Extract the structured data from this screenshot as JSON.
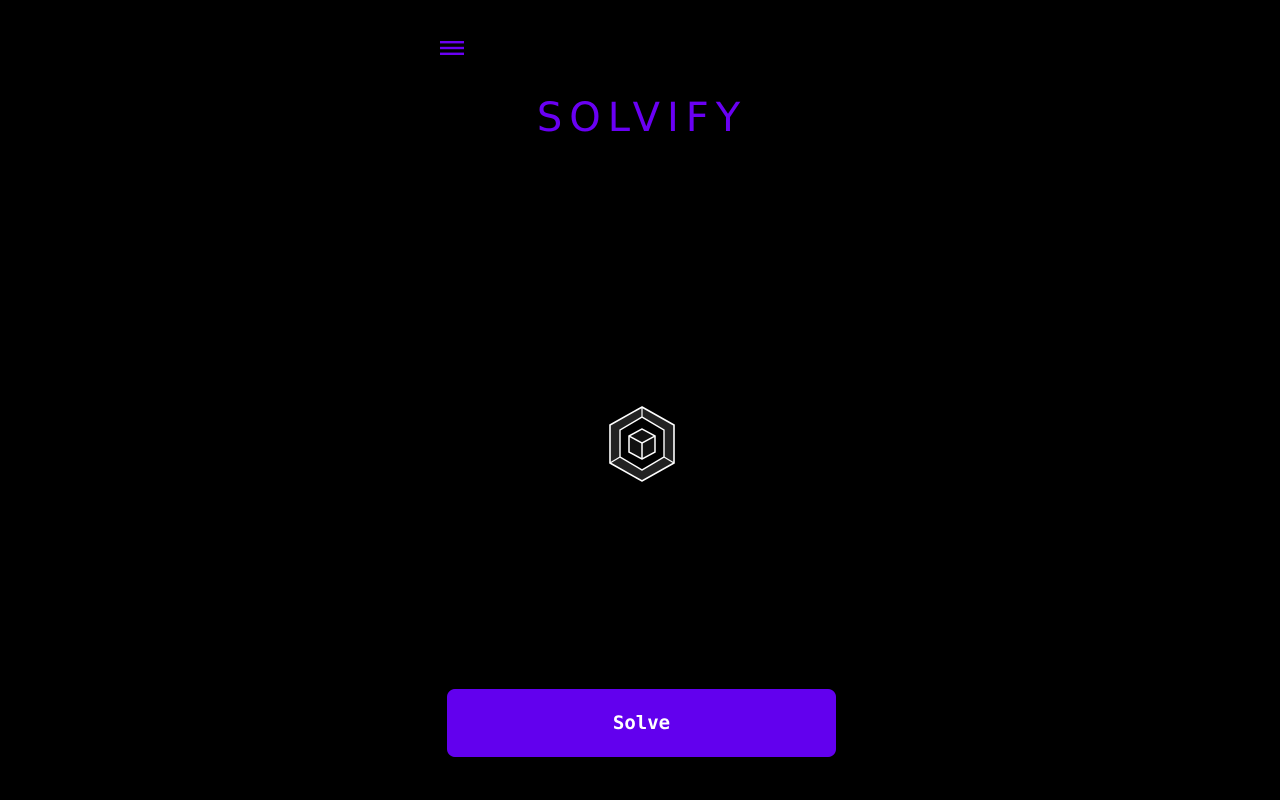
{
  "header": {
    "menu_icon": "hamburger-menu-icon",
    "title": "SOLVIFY"
  },
  "main": {
    "logo_icon": "cube-icon"
  },
  "footer": {
    "solve_label": "Solve"
  },
  "colors": {
    "background": "#000000",
    "accent": "#6200ee",
    "title": "#6a00f4",
    "cube_stroke": "#ffffff",
    "cube_fill": "#222222"
  }
}
